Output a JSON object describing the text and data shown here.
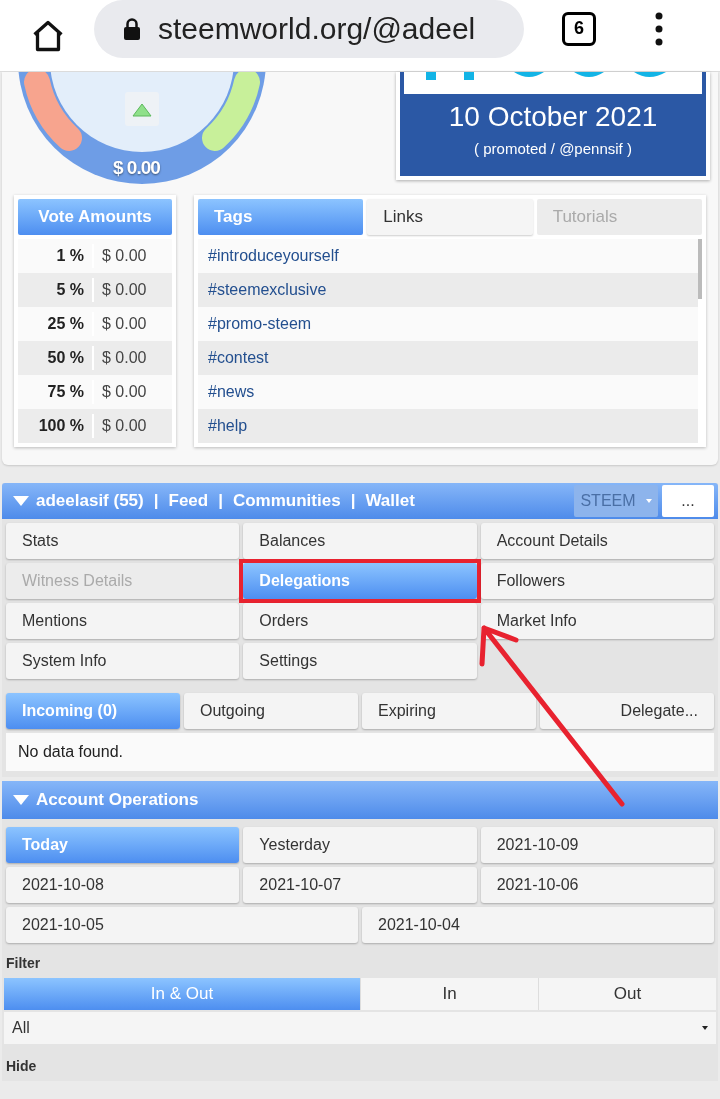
{
  "browser": {
    "url": "steemworld.org/@adeel",
    "tab_count": "6"
  },
  "gauge": {
    "value": "$ 0.00"
  },
  "promo": {
    "date": "10 October 2021",
    "caption": "( promoted / @pennsif )"
  },
  "vote_amounts": {
    "title": "Vote Amounts",
    "rows": [
      {
        "percent": "1 %",
        "value": "$ 0.00"
      },
      {
        "percent": "5 %",
        "value": "$ 0.00"
      },
      {
        "percent": "25 %",
        "value": "$ 0.00"
      },
      {
        "percent": "50 %",
        "value": "$ 0.00"
      },
      {
        "percent": "75 %",
        "value": "$ 0.00"
      },
      {
        "percent": "100 %",
        "value": "$ 0.00"
      }
    ]
  },
  "tags_panel": {
    "tabs": [
      {
        "label": "Tags",
        "selected": true,
        "disabled": false
      },
      {
        "label": "Links",
        "selected": false,
        "disabled": false
      },
      {
        "label": "Tutorials",
        "selected": false,
        "disabled": true
      }
    ],
    "tags": [
      "#introduceyourself",
      "#steemexclusive",
      "#promo-steem",
      "#contest",
      "#news",
      "#help"
    ]
  },
  "account_bar": {
    "expanded": true,
    "separator": "|",
    "links": [
      "adeelasif (55)",
      "Feed",
      "Communities",
      "Wallet"
    ],
    "currency": "STEEM",
    "more": "..."
  },
  "menu": [
    {
      "label": "Stats",
      "selected": false,
      "disabled": false,
      "highlighted": false
    },
    {
      "label": "Balances",
      "selected": false,
      "disabled": false,
      "highlighted": false
    },
    {
      "label": "Account Details",
      "selected": false,
      "disabled": false,
      "highlighted": false
    },
    {
      "label": "Witness Details",
      "selected": false,
      "disabled": true,
      "highlighted": false
    },
    {
      "label": "Delegations",
      "selected": true,
      "disabled": false,
      "highlighted": true
    },
    {
      "label": "Followers",
      "selected": false,
      "disabled": false,
      "highlighted": false
    },
    {
      "label": "Mentions",
      "selected": false,
      "disabled": false,
      "highlighted": false
    },
    {
      "label": "Orders",
      "selected": false,
      "disabled": false,
      "highlighted": false
    },
    {
      "label": "Market Info",
      "selected": false,
      "disabled": false,
      "highlighted": false
    },
    {
      "label": "System Info",
      "selected": false,
      "disabled": false,
      "highlighted": false
    },
    {
      "label": "Settings",
      "selected": false,
      "disabled": false,
      "highlighted": false
    }
  ],
  "delegations": {
    "tabs": [
      {
        "label": "Incoming (0)",
        "selected": true
      },
      {
        "label": "Outgoing",
        "selected": false
      },
      {
        "label": "Expiring",
        "selected": false
      },
      {
        "label": "Delegate...",
        "selected": false
      }
    ],
    "message": "No data found."
  },
  "account_operations": {
    "title": "Account Operations",
    "expanded": true,
    "days": [
      {
        "label": "Today",
        "selected": true
      },
      {
        "label": "Yesterday",
        "selected": false
      },
      {
        "label": "2021-10-09",
        "selected": false
      },
      {
        "label": "2021-10-08",
        "selected": false
      },
      {
        "label": "2021-10-07",
        "selected": false
      },
      {
        "label": "2021-10-06",
        "selected": false
      },
      {
        "label": "2021-10-05",
        "selected": false
      },
      {
        "label": "2021-10-04",
        "selected": false
      }
    ],
    "filter_label": "Filter",
    "filter_tabs": [
      {
        "label": "In & Out",
        "selected": true
      },
      {
        "label": "In",
        "selected": false
      },
      {
        "label": "Out",
        "selected": false
      }
    ],
    "select_value": "All",
    "hide_label": "Hide"
  }
}
